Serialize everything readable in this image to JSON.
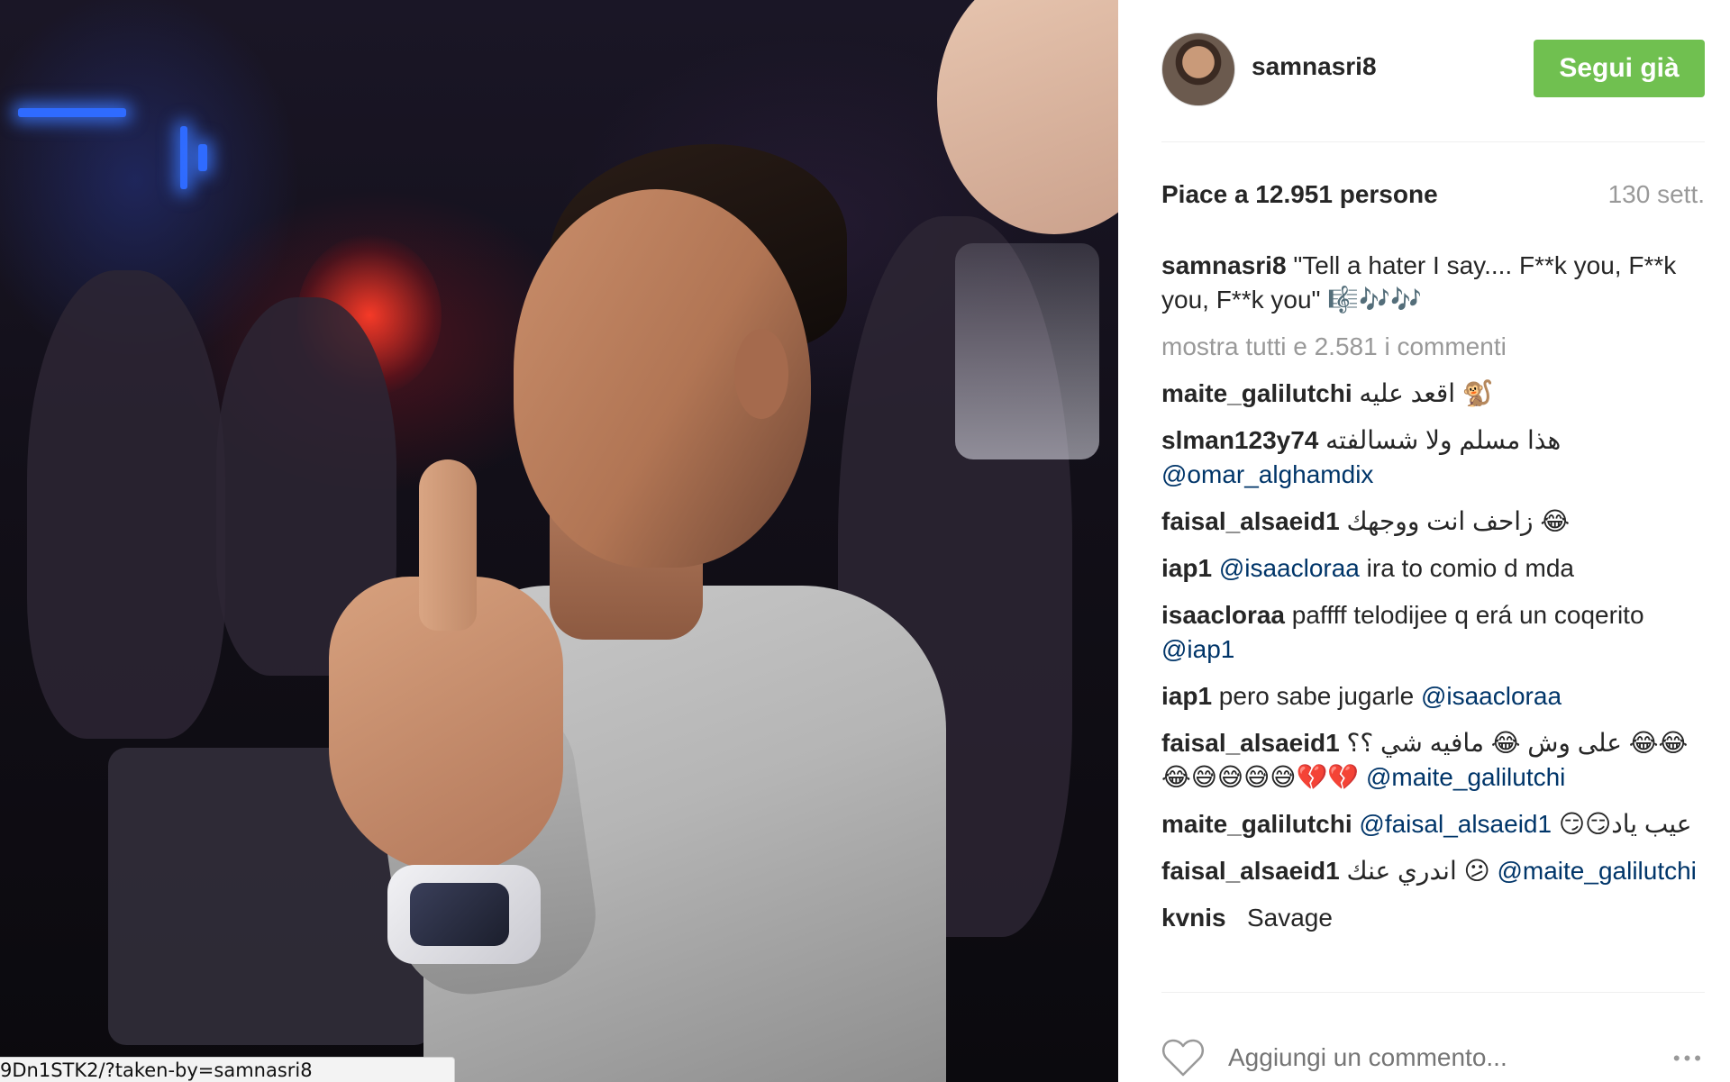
{
  "photo": {
    "status_url": "9Dn1STK2/?taken-by=samnasri8"
  },
  "post": {
    "username": "samnasri8",
    "follow_label": "Segui già",
    "likes": "Piace a 12.951 persone",
    "age": "130 sett.",
    "caption_user": "samnasri8",
    "caption_text": " \"Tell a hater I say.... F**k you, F**k you, F**k you\" 🎼🎶🎶",
    "view_all": "mostra tutti e 2.581 i commenti",
    "add_comment_placeholder": "Aggiungi un commento...",
    "more_icon": "•••"
  },
  "comments": [
    {
      "user": "maite_galilutchi",
      "text": " اقعد عليه 🐒",
      "mention": ""
    },
    {
      "user": "slman123y74",
      "text": " هذا مسلم ولا شسالفته",
      "mention": "@omar_alghamdix"
    },
    {
      "user": "faisal_alsaeid1",
      "text": " زاحف انت ووجهك 😂",
      "mention": ""
    },
    {
      "user": "iap1",
      "text": " ira to comio d mda",
      "mention_first": "@isaacloraa"
    },
    {
      "user": "isaacloraa",
      "text": " paffff telodijee q erá un coqerito ",
      "mention": "@iap1"
    },
    {
      "user": "iap1",
      "text": " pero sabe jugarle ",
      "mention": "@isaacloraa"
    },
    {
      "user": "faisal_alsaeid1",
      "text": " على وش 😂 مافيه شي ؟؟ 😂😂😂😅😅😅😅💔💔 ",
      "mention": "@maite_galilutchi"
    },
    {
      "user": "maite_galilutchi",
      "text": " 😏😏عيب ياد",
      "mention_first": "@faisal_alsaeid1"
    },
    {
      "user": "faisal_alsaeid1",
      "text": " اندري عنك 😕 ",
      "mention": "@maite_galilutchi"
    },
    {
      "user": "kvnis",
      "text": "   Savage",
      "mention": ""
    }
  ],
  "colors": {
    "follow_bg": "#70c050",
    "mention": "#003569",
    "muted": "#999999",
    "text": "#262626"
  }
}
